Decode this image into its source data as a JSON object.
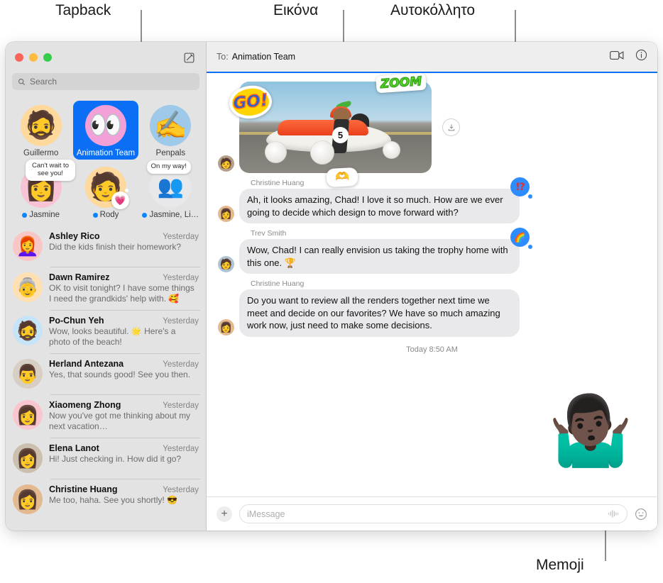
{
  "callouts": [
    {
      "label": "Tapback",
      "id": "tapback"
    },
    {
      "label": "Εικόνα",
      "id": "image"
    },
    {
      "label": "Αυτοκόλλητο",
      "id": "sticker"
    },
    {
      "label": "Memoji",
      "id": "memoji"
    }
  ],
  "window": {
    "traffic_lights": [
      "close",
      "minimize",
      "zoom"
    ],
    "compose_icon": "compose-icon"
  },
  "sidebar": {
    "search": {
      "placeholder": "Search",
      "icon": "search-icon"
    },
    "pinned": [
      {
        "name": "Guillermo",
        "avatar": "🧔",
        "bg": "#ffd89b",
        "selected": false,
        "unread": false
      },
      {
        "name": "Animation Team",
        "avatar": "👀",
        "bg": "#f3a0d8",
        "selected": true,
        "unread": false
      },
      {
        "name": "Penpals",
        "avatar": "✍️",
        "bg": "#9fc9e8",
        "selected": false,
        "unread": false
      },
      {
        "name": "Jasmine",
        "avatar": "👩",
        "bg": "#f8c3d4",
        "selected": false,
        "unread": true,
        "tip": "Can't wait to see you!"
      },
      {
        "name": "Rody",
        "avatar": "🧑",
        "bg": "#ffd89b",
        "selected": false,
        "unread": true,
        "tapback": "💗"
      },
      {
        "name": "Jasmine, Li…",
        "avatar": "👥",
        "bg": "#e8e8ea",
        "selected": false,
        "unread": true,
        "tip": "On my way!"
      }
    ],
    "conversations": [
      {
        "name": "Ashley Rico",
        "time": "Yesterday",
        "preview": "Did the kids finish their homework?",
        "avatar": "👩‍🦰",
        "bg": "#f9c6c6"
      },
      {
        "name": "Dawn Ramirez",
        "time": "Yesterday",
        "preview": "OK to visit tonight? I have some things I need the grandkids' help with. 🥰",
        "avatar": "👵",
        "bg": "#ffe0b2"
      },
      {
        "name": "Po-Chun Yeh",
        "time": "Yesterday",
        "preview": "Wow, looks beautiful. 🌟 Here's a photo of the beach!",
        "avatar": "🧔",
        "bg": "#c5e4f7"
      },
      {
        "name": "Herland Antezana",
        "time": "Yesterday",
        "preview": "Yes, that sounds good! See you then.",
        "avatar": "👨",
        "bg": "#d7cfc4"
      },
      {
        "name": "Xiaomeng Zhong",
        "time": "Yesterday",
        "preview": "Now you've got me thinking about my next vacation…",
        "avatar": "👩",
        "bg": "#f9c6cf"
      },
      {
        "name": "Elena Lanot",
        "time": "Yesterday",
        "preview": "Hi! Just checking in. How did it go?",
        "avatar": "👩",
        "bg": "#cbbfae"
      },
      {
        "name": "Christine Huang",
        "time": "Yesterday",
        "preview": "Me too, haha. See you shortly! 😎",
        "avatar": "👩",
        "bg": "#e3b98f"
      }
    ]
  },
  "chat": {
    "header": {
      "to_label": "To:",
      "recipient": "Animation Team",
      "facetime_icon": "facetime-video-icon",
      "info_icon": "info-icon"
    },
    "photo_message": {
      "sender_avatar": "🧑",
      "stickers": [
        {
          "name": "go-sticker",
          "text": "GO!"
        },
        {
          "name": "zoom-sticker",
          "text": "ZOOM"
        },
        {
          "name": "heart-hands-sticker",
          "text": "🫶"
        }
      ],
      "car_number": "5",
      "save_icon": "download-icon"
    },
    "messages": [
      {
        "sender": "Christine Huang",
        "text": "Ah, it looks amazing, Chad! I love it so much. How are we ever going to decide which design to move forward with?",
        "avatar": "👩",
        "avatar_bg": "#e3b98f",
        "tapback": "‼️",
        "tapback_type": "exclaim"
      },
      {
        "sender": "Trev Smith",
        "text": "Wow, Chad! I can really envision us taking the trophy home with this one. 🏆",
        "avatar": "🧑",
        "avatar_bg": "#b0c4d4",
        "tapback": "🌈",
        "tapback_type": "emoji"
      },
      {
        "sender": "Christine Huang",
        "text": "Do you want to review all the renders together next time we meet and decide on our favorites? We have so much amazing work now, just need to make some decisions.",
        "avatar": "👩",
        "avatar_bg": "#e3b98f",
        "tapback": null,
        "tapback_type": null
      }
    ],
    "timestamp": "Today 8:50 AM",
    "memoji_overlay": "🤷🏿‍♂️",
    "input": {
      "placeholder": "iMessage",
      "plus_icon": "plus-icon",
      "audio_icon": "audio-waveform-icon",
      "emoji_icon": "emoji-smiley-icon"
    }
  },
  "colors": {
    "accent_blue": "#0a6ff5",
    "tapback_blue": "#2d8cff",
    "bubble_gray": "#e9e9eb",
    "sidebar_bg": "#e4e3e3",
    "unread_dot": "#0a84ff"
  }
}
